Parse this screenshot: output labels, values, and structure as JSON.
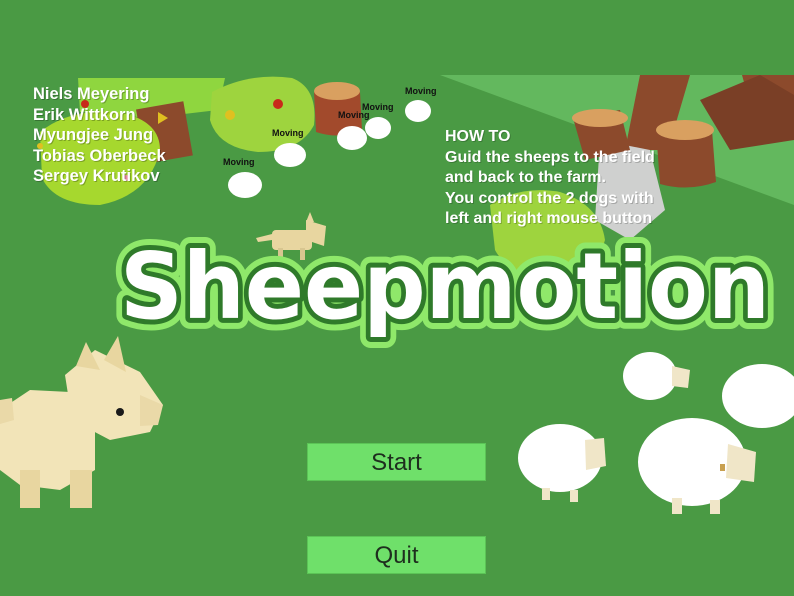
{
  "game": {
    "title": "Sheepmotion"
  },
  "credits": [
    "Niels Meyering",
    "Erik Wittkorn",
    "Myungjee Jung",
    "Tobias Oberbeck",
    "Sergey Krutikov"
  ],
  "howto": {
    "heading": "HOW TO",
    "lines": [
      "Guid the sheeps to the field",
      "and back to the farm.",
      "You control the 2 dogs with",
      "left and right mouse button"
    ]
  },
  "sheep_status": [
    "Moving",
    "Moving",
    "Moving",
    "Moving",
    "Moving"
  ],
  "menu": {
    "start_label": "Start",
    "quit_label": "Quit"
  },
  "colors": {
    "grass": "#4a9a44",
    "field": "#63b85e",
    "button": "#6fe06a",
    "tree_trunk": "#8c4a2c",
    "foliage": "#9ed43e",
    "dog": "#f2e4b8",
    "sheep": "#ffffff"
  },
  "icons": [
    "dog-icon",
    "sheep-icon",
    "tree-icon",
    "stump-icon",
    "flower-icon"
  ]
}
